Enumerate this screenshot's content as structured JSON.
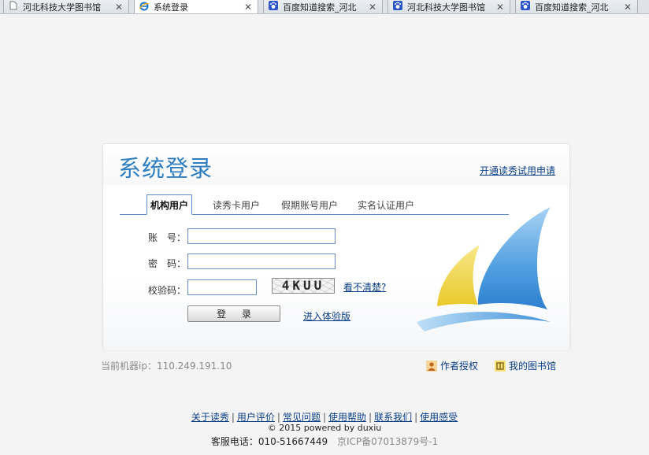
{
  "browser": {
    "tabs": [
      {
        "title": "河北科技大学图书馆",
        "icon": "page-icon",
        "active": false
      },
      {
        "title": "系统登录",
        "icon": "ie-icon",
        "active": true
      },
      {
        "title": "百度知道搜索_河北",
        "icon": "baidu-paw-icon",
        "active": false
      },
      {
        "title": "河北科技大学图书馆",
        "icon": "baidu-paw-icon",
        "active": false
      },
      {
        "title": "百度知道搜索_河北",
        "icon": "baidu-paw-icon",
        "active": false
      }
    ],
    "close_glyph": "✕"
  },
  "login": {
    "title": "系统登录",
    "trial_link": "开通读秀试用申请",
    "tabs": [
      {
        "label": "机构用户",
        "active": true
      },
      {
        "label": "读秀卡用户",
        "active": false
      },
      {
        "label": "假期账号用户",
        "active": false
      },
      {
        "label": "实名认证用户",
        "active": false
      }
    ],
    "account_label": "账　号：",
    "account_value": "",
    "password_label": "密　码：",
    "password_value": "",
    "captcha_label": "校验码：",
    "captcha_value": "",
    "captcha_text": "4KUU",
    "captcha_refresh": "看不清楚?",
    "login_button": "登 录",
    "demo_link": "进入体验版"
  },
  "below": {
    "machine_ip": "当前机器ip：110.249.191.10",
    "author_auth": "作者授权",
    "my_library": "我的图书馆"
  },
  "footer": {
    "links": [
      "关于读秀",
      "用户评价",
      "常见问题",
      "使用帮助",
      "联系我们",
      "使用感受"
    ],
    "separator": "|",
    "copyright": "© 2015 powered by duxiu",
    "service_phone": "客服电话：010-51667449",
    "icp": "京ICP备07013879号-1"
  },
  "colors": {
    "title_blue": "#2f7ec0",
    "link_blue": "#0b3f86",
    "tab_line": "#5c8fc9",
    "sail_yellow": "#f0d84a",
    "sail_blue": "#4f9fe0"
  }
}
